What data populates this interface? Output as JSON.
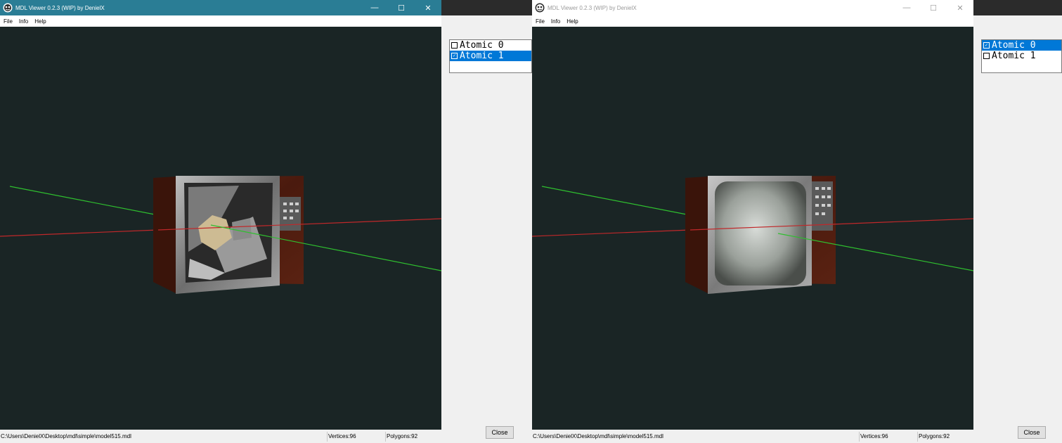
{
  "left_window": {
    "title": "MDL Viewer 0.2.3 (WIP) by DenielX",
    "controls": {
      "minimize": "—",
      "maximize": "☐",
      "close": "✕"
    },
    "menu": [
      "File",
      "Info",
      "Help"
    ],
    "status": {
      "path": "C:\\Users\\DenielX\\Desktop\\mdl\\simple\\model515.mdl",
      "vertices": "Vertices:96",
      "polygons": "Polygons:92"
    }
  },
  "left_panel": {
    "items": [
      {
        "label": "Atomic 0",
        "checked": false,
        "selected": false
      },
      {
        "label": "Atomic 1",
        "checked": true,
        "selected": true
      }
    ],
    "close_label": "Close"
  },
  "right_window": {
    "title": "MDL Viewer 0.2.3 (WIP) by DenielX",
    "controls": {
      "minimize": "—",
      "maximize": "☐",
      "close": "✕"
    },
    "menu": [
      "File",
      "Info",
      "Help"
    ],
    "status": {
      "path": "C:\\Users\\DenielX\\Desktop\\mdl\\simple\\model515.mdl",
      "vertices": "Vertices:96",
      "polygons": "Polygons:92"
    }
  },
  "right_panel": {
    "items": [
      {
        "label": "Atomic 0",
        "checked": true,
        "selected": true
      },
      {
        "label": "Atomic 1",
        "checked": false,
        "selected": false
      }
    ],
    "close_label": "Close"
  },
  "colors": {
    "active_titlebar": "#2a7d95",
    "viewport_bg": "#1a2525",
    "selection": "#0078d7",
    "axis_x": "#c0282a",
    "axis_y": "#2fbf2f"
  }
}
